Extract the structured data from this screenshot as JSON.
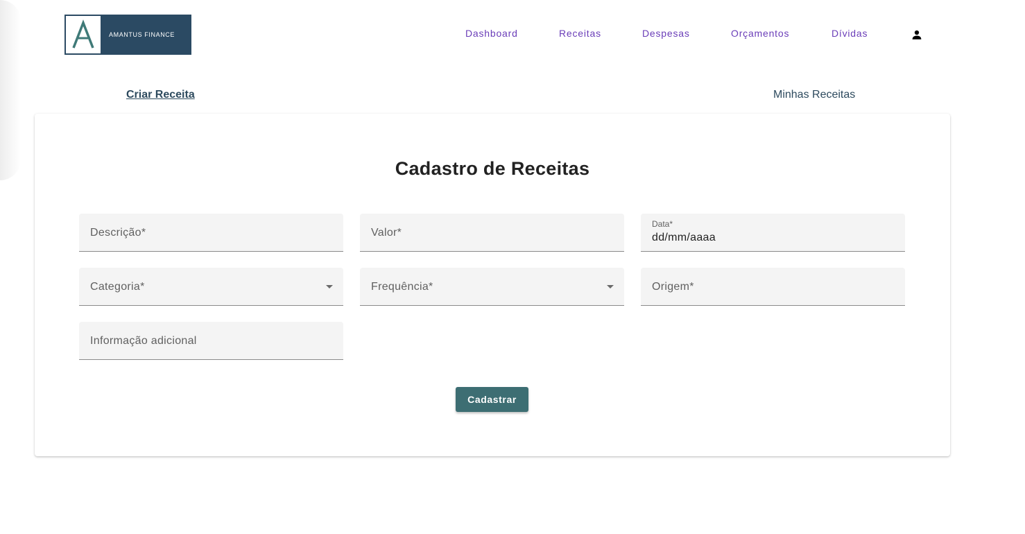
{
  "brand": {
    "logo_letter": "A",
    "name": "AMANTUS FINANCE",
    "color": "#2b4a63"
  },
  "nav": {
    "items": [
      {
        "label": "Dashboard"
      },
      {
        "label": "Receitas"
      },
      {
        "label": "Despesas"
      },
      {
        "label": "Orçamentos"
      },
      {
        "label": "Dívidas"
      }
    ],
    "user_icon": "user-icon",
    "link_color": "#6a3db8"
  },
  "subtabs": {
    "create": "Criar Receita",
    "list": "Minhas Receitas"
  },
  "form": {
    "title": "Cadastro de Receitas",
    "fields": {
      "descricao": {
        "label": "Descrição*"
      },
      "valor": {
        "label": "Valor*"
      },
      "data": {
        "label": "Data*",
        "value": "dd/mm/aaaa"
      },
      "categoria": {
        "label": "Categoria*"
      },
      "frequencia": {
        "label": "Frequência*"
      },
      "origem": {
        "label": "Origem*"
      },
      "info": {
        "label": "Informação adicional"
      }
    },
    "submit_label": "Cadastrar",
    "submit_color": "#3d6e73"
  }
}
